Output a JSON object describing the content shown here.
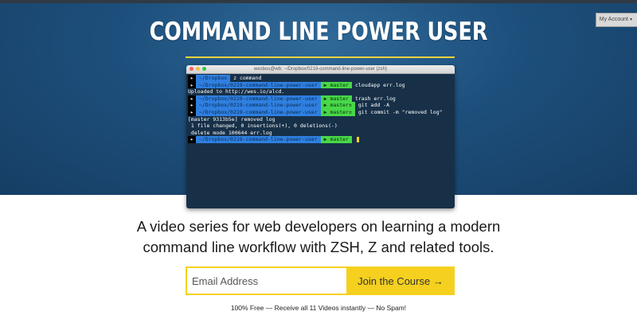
{
  "header": {
    "account_label": "My Account",
    "account_caret": "▾",
    "title": "COMMAND LINE POWER USER"
  },
  "colors": {
    "hero_bg": "#1d4f7c",
    "accent": "#f5d01f",
    "terminal_bg": "#173048",
    "prompt_path": "#2f7fe0",
    "prompt_branch": "#48d848"
  },
  "terminal": {
    "window_title": "wesbos@wb: ~/Dropbox/0219-command-line-power-user (zsh)",
    "lines": [
      {
        "kind": "prompt",
        "arrow": "▸",
        "path": "~/Dropbox",
        "branch": "",
        "cmd": "z command"
      },
      {
        "kind": "prompt",
        "arrow": "▸",
        "path": "~/Dropbox/0219-command-line-power-user",
        "branch": "▶ master",
        "cmd": "cloudapp err.log"
      },
      {
        "kind": "output",
        "text": "Uploaded to http://wes.io/alcd."
      },
      {
        "kind": "prompt",
        "arrow": "▸",
        "path": "~/Dropbox/0219-command-line-power-user",
        "branch": "▶ master",
        "cmd": "trash err.log"
      },
      {
        "kind": "prompt",
        "arrow": "▸",
        "path": "~/Dropbox/0219-command-line-power-user",
        "branch": "▶ master±",
        "cmd": "git add -A"
      },
      {
        "kind": "prompt",
        "arrow": "▸",
        "path": "~/Dropbox/0219-command-line-power-user",
        "branch": "▶ master±",
        "cmd": "git commit -m \"removed log\""
      },
      {
        "kind": "output",
        "text": "[master 9313b5e] removed log"
      },
      {
        "kind": "output",
        "text": " 1 file changed, 0 insertions(+), 0 deletions(-)"
      },
      {
        "kind": "output",
        "text": " delete mode 100644 err.log"
      },
      {
        "kind": "prompt",
        "arrow": "▸",
        "path": "~/Dropbox/0219-command-line-power-user",
        "branch": "▶ master",
        "cmd": "",
        "cursor": true
      }
    ]
  },
  "main": {
    "tagline_line1": "A video series for web developers on learning a modern",
    "tagline_line2": "command line workflow with ZSH, Z and related tools."
  },
  "signup": {
    "email_placeholder": "Email Address",
    "email_value": "",
    "button_label": "Join the Course →",
    "footnote": "100% Free — Receive all 11 Videos instantly — No Spam!"
  }
}
